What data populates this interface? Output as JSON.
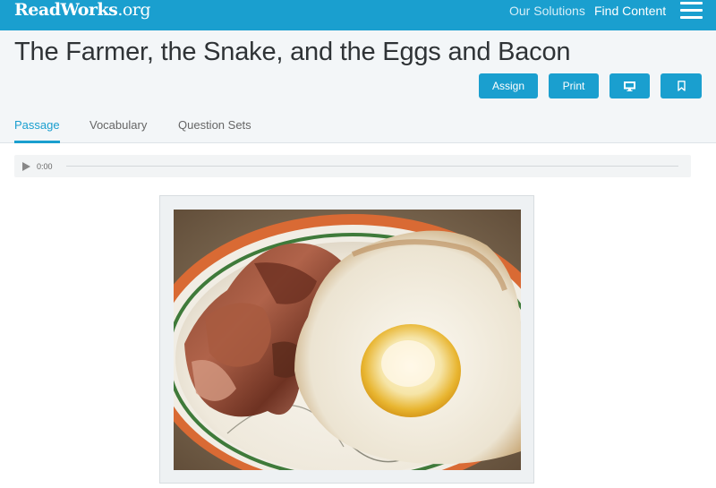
{
  "topbar": {
    "logo_main": "ReadWorks",
    "logo_suffix": ".org",
    "nav": {
      "our_solutions": "Our Solutions",
      "find_content": "Find Content"
    },
    "menu_icon": "hamburger-icon",
    "background_color": "#1a9fcf"
  },
  "header": {
    "title": "The Farmer, the Snake, and the Eggs and Bacon",
    "buttons": {
      "assign": "Assign",
      "print": "Print",
      "present_icon": "monitor-icon",
      "bookmark_icon": "bookmark-icon"
    },
    "tabs": [
      {
        "label": "Passage",
        "active": true
      },
      {
        "label": "Vocabulary",
        "active": false
      },
      {
        "label": "Question Sets",
        "active": false
      }
    ]
  },
  "audio": {
    "play_icon": "play-icon",
    "time": "0:00",
    "progress": 0
  },
  "passage_image": {
    "subject": "eggs-and-bacon-photo"
  },
  "colors": {
    "accent": "#1a9fcf",
    "panel": "#f3f6f8"
  }
}
